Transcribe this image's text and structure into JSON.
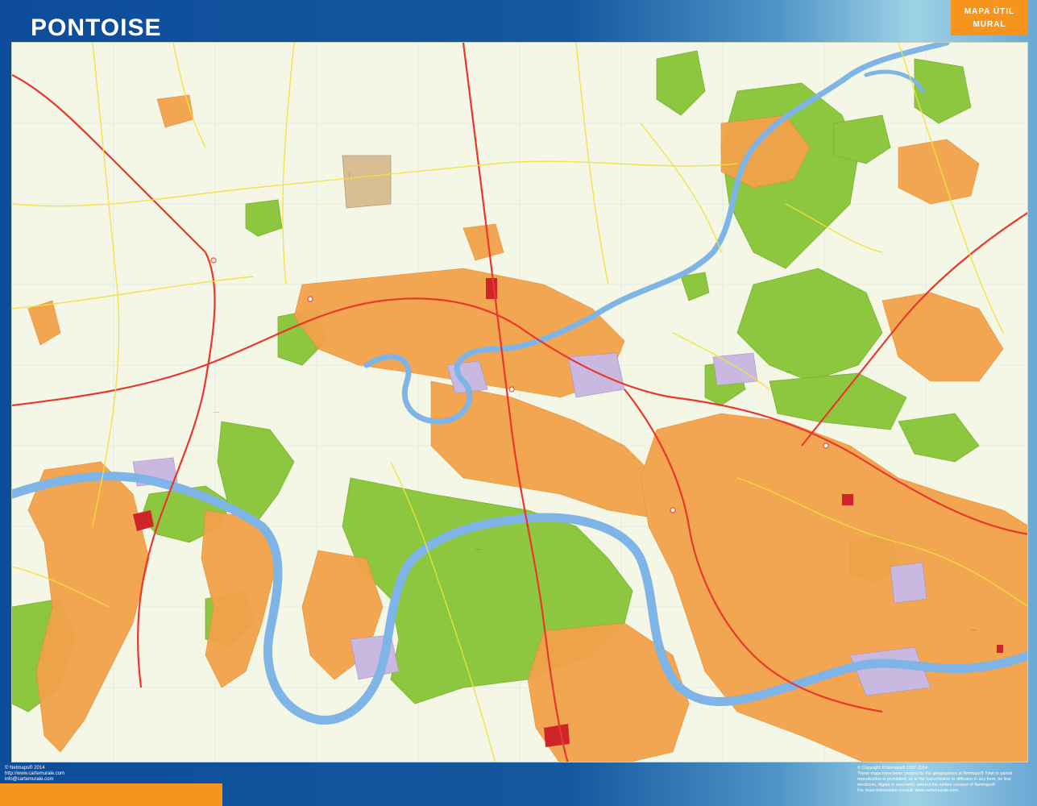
{
  "header": {
    "title": "PONTOISE",
    "badge_line1": "MAPA ÚTIL",
    "badge_line2": "MURAL"
  },
  "colors": {
    "frame_blue": "#0f4f9c",
    "badge_orange": "#f7941d",
    "map_background": "#f4f6e6",
    "urban": "#f2a24a",
    "forest": "#8dc63f",
    "river": "#7fb4e6",
    "industrial": "#c9b8e0",
    "main_road": "#e8382e",
    "secondary_road": "#f2e23a"
  },
  "footer": {
    "left_lines": [
      "© Netmaps® 2014",
      "http://www.cartemurale.com",
      "info@cartemurale.com"
    ],
    "right_lines": [
      "© Copyright ©Netmaps® 1997-2014",
      "These maps have been created by the geographers at Netmaps® Total or partial",
      "reproduction is prohibited; as is the transmission or diffusion in any form, be that",
      "electronic, digital or mechanic; without the written consent of Netmaps®",
      "For more information consult: www.cartemurale.com"
    ]
  }
}
